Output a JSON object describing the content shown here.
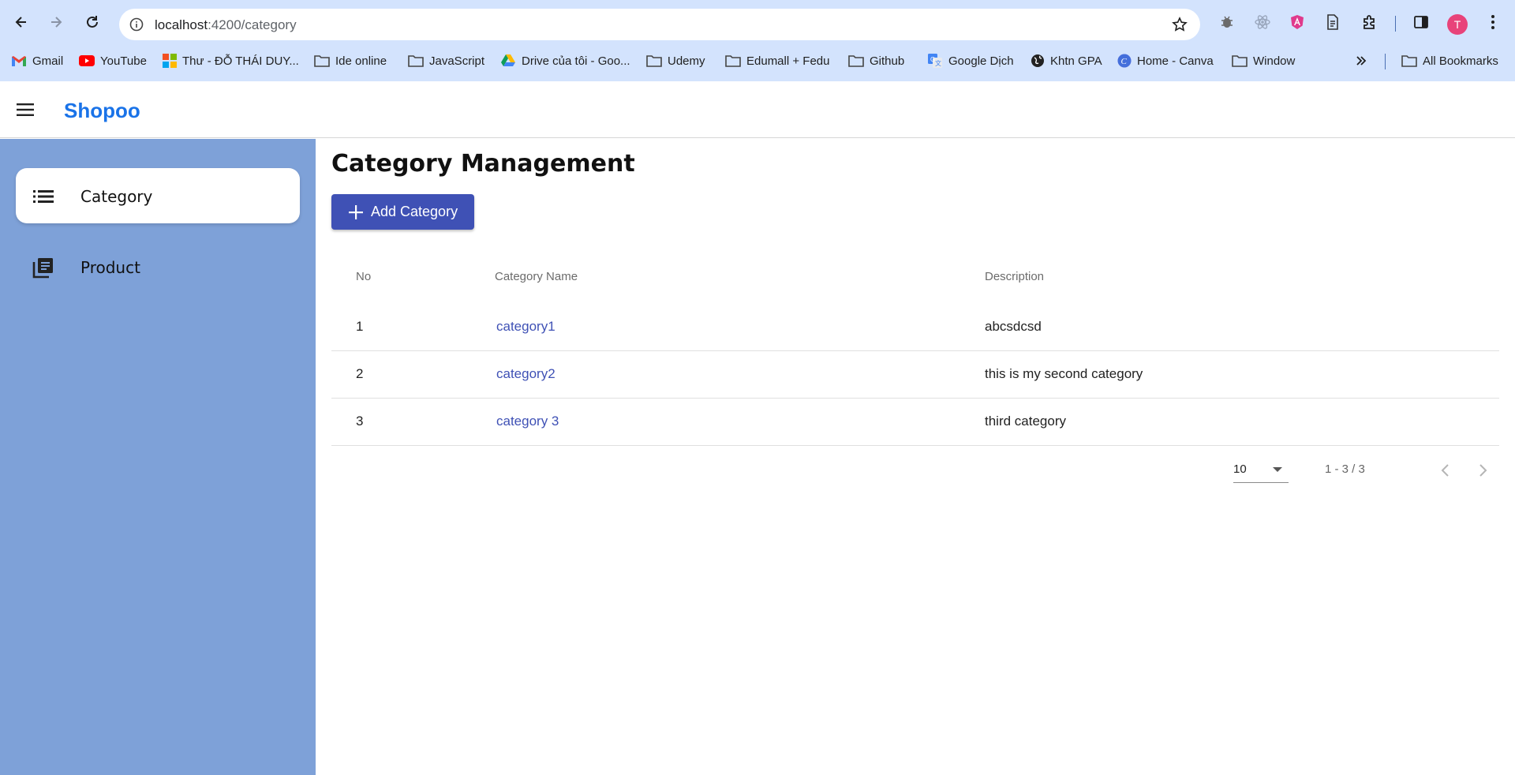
{
  "browser": {
    "url_host": "localhost",
    "url_path": ":4200/category",
    "avatar_letter": "T",
    "bookmarks": [
      {
        "label": "Gmail",
        "icon": "gmail-icon"
      },
      {
        "label": "YouTube",
        "icon": "youtube-icon"
      },
      {
        "label": "Thư - ĐỖ THÁI DUY...",
        "icon": "microsoft-icon"
      },
      {
        "label": "Ide online",
        "icon": "folder-icon"
      },
      {
        "label": "JavaScript",
        "icon": "folder-icon"
      },
      {
        "label": "Drive của tôi - Goo...",
        "icon": "google-drive-icon"
      },
      {
        "label": "Udemy",
        "icon": "folder-icon"
      },
      {
        "label": "Edumall + Fedu",
        "icon": "folder-icon"
      },
      {
        "label": "Github",
        "icon": "folder-icon"
      },
      {
        "label": "Google Dịch",
        "icon": "google-translate-icon"
      },
      {
        "label": "Khtn GPA",
        "icon": "globe-icon"
      },
      {
        "label": "Home - Canva",
        "icon": "canva-icon"
      },
      {
        "label": "Window",
        "icon": "folder-icon"
      }
    ],
    "all_bookmarks": "All Bookmarks"
  },
  "app": {
    "brand": "Shopoo"
  },
  "sidebar": {
    "items": [
      {
        "label": "Category",
        "icon": "list-icon",
        "active": true
      },
      {
        "label": "Product",
        "icon": "library-books-icon",
        "active": false
      }
    ]
  },
  "main": {
    "title": "Category Management",
    "add_button": "Add Category",
    "columns": [
      "No",
      "Category Name",
      "Description"
    ],
    "rows": [
      {
        "no": "1",
        "name": "category1",
        "description": "abcsdcsd"
      },
      {
        "no": "2",
        "name": "category2",
        "description": "this is my second category"
      },
      {
        "no": "3",
        "name": "category 3",
        "description": "third category"
      }
    ],
    "paginator": {
      "page_size": "10",
      "range": "1 - 3 / 3"
    }
  },
  "colors": {
    "chrome_bg": "#d3e3fd",
    "sidebar_bg": "#7ea1d8",
    "primary": "#3f51b5",
    "brand": "#1a73e8"
  }
}
